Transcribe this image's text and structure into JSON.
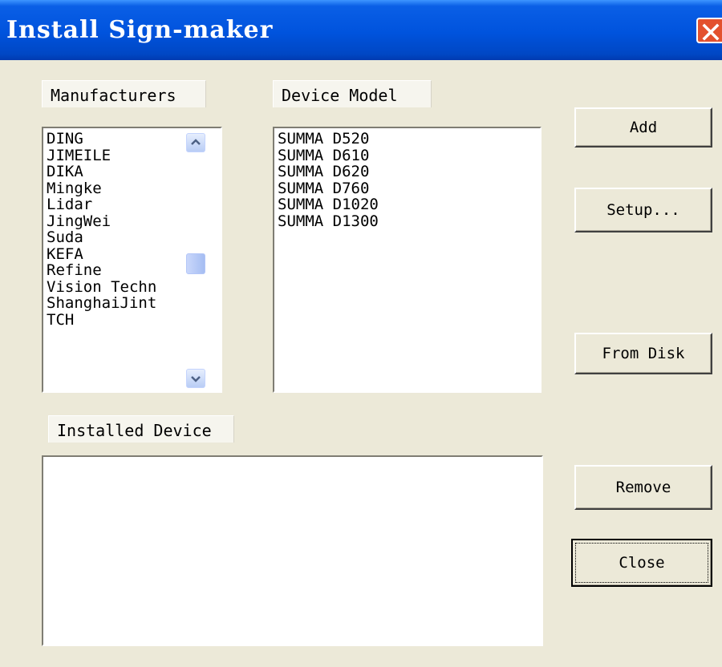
{
  "window": {
    "title": "Install Sign-maker"
  },
  "manufacturers": {
    "label": "Manufacturers",
    "items": [
      "DING",
      "JIMEILE",
      "DIKA",
      "Mingke",
      "Lidar",
      "JingWei",
      "Suda",
      "KEFA",
      "Refine",
      "Vision Techn",
      "ShanghaiJint",
      "TCH"
    ]
  },
  "device_model": {
    "label": "Device Model",
    "items": [
      "SUMMA D520",
      "SUMMA D610",
      "SUMMA D620",
      "SUMMA D760",
      "SUMMA D1020",
      "SUMMA D1300"
    ]
  },
  "installed_device": {
    "label": "Installed Device",
    "items": []
  },
  "buttons": {
    "add": "Add",
    "setup": "Setup...",
    "from_disk": "From Disk",
    "remove": "Remove",
    "close": "Close"
  },
  "icons": {
    "window_close": "close-icon",
    "scroll_up": "chevron-up-icon",
    "scroll_down": "chevron-down-icon"
  },
  "colors": {
    "titlebar": "#0053DD",
    "dialog_bg": "#ECE9D8",
    "close_button": "#E3512E"
  }
}
